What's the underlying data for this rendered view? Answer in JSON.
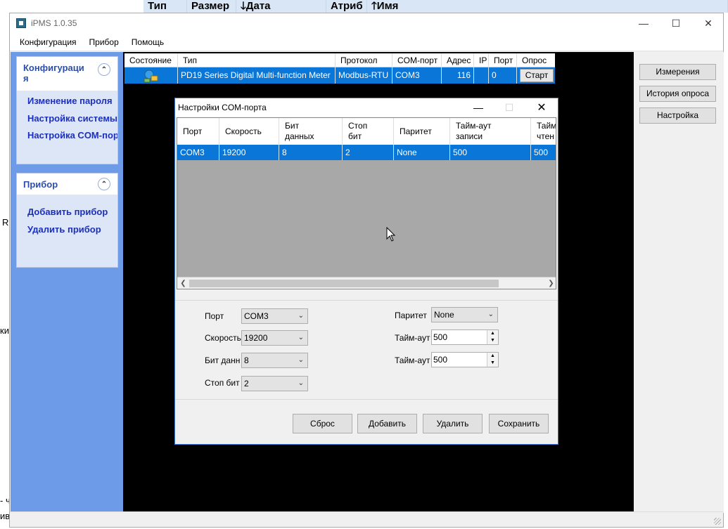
{
  "background": {
    "columns": [
      "Тип",
      "Размер",
      "🡓Дата",
      "Атриб",
      "🡑Имя"
    ],
    "fragments": [
      "R",
      "ки",
      "- ч",
      "ив"
    ]
  },
  "app": {
    "title": "iPMS 1.0.35",
    "menu": [
      "Конфигурация",
      "Прибор",
      "Помощь"
    ]
  },
  "sidebar": {
    "config_title": "Конфигураци\nя",
    "config_links": [
      "Изменение пароля",
      "Настройка системы",
      "Настройка COM-пор"
    ],
    "device_title": "Прибор",
    "device_links": [
      "Добавить прибор",
      "Удалить прибор"
    ]
  },
  "device_grid": {
    "headers": [
      "Состояние",
      "Тип",
      "Протокол",
      "COM-порт",
      "Адрес",
      "IP",
      "Порт",
      "Опрос"
    ],
    "row": {
      "type": "PD19 Series Digital Multi-function Meter",
      "protocol": "Modbus-RTU",
      "com": "COM3",
      "address": "116",
      "ip": "",
      "port": "0",
      "poll_button": "Старт"
    }
  },
  "right_buttons": [
    "Измерения",
    "История опроса",
    "Настройка"
  ],
  "dialog": {
    "title": "Настройки COM-порта",
    "headers": [
      "Порт",
      "Скорость",
      "Бит\nданных",
      "Стоп\nбит",
      "Паритет",
      "Тайм-аут\nзаписи",
      "Тайм\nчтен"
    ],
    "row": [
      "COM3",
      "19200",
      "8",
      "2",
      "None",
      "500",
      "500"
    ],
    "form": {
      "port_label": "Порт",
      "port_value": "COM3",
      "speed_label": "Скорость",
      "speed_value": "19200",
      "databits_label": "Бит данн",
      "databits_value": "8",
      "stopbits_label": "Стоп бит",
      "stopbits_value": "2",
      "parity_label": "Паритет",
      "parity_value": "None",
      "timeout1_label": "Тайм-аут",
      "timeout1_value": "500",
      "timeout2_label": "Тайм-аут",
      "timeout2_value": "500"
    },
    "buttons": [
      "Сброс",
      "Добавить",
      "Удалить",
      "Сохранить"
    ]
  }
}
